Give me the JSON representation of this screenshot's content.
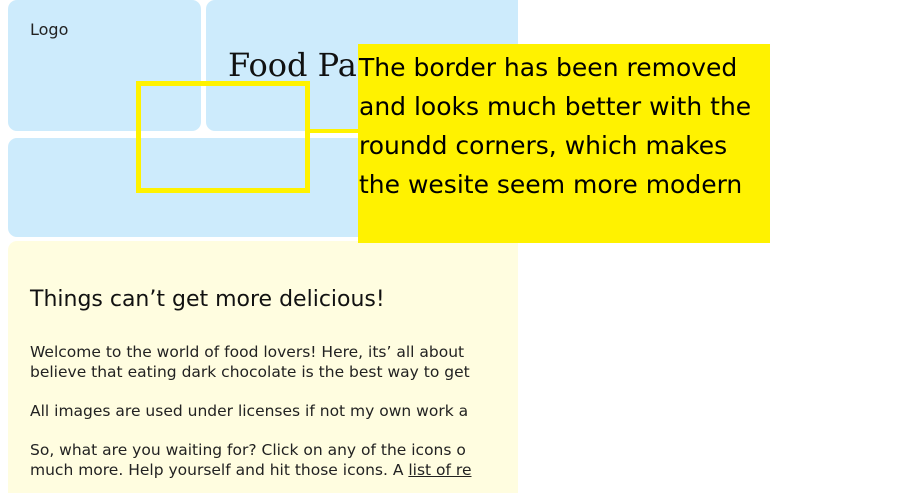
{
  "header": {
    "logo": "Logo",
    "title": "Food Pa"
  },
  "content": {
    "heading": "Things can’t get more delicious!",
    "paragraph1_line1": "Welcome to the world of food lovers! Here, its’ all about",
    "paragraph1_line2": "believe that eating dark chocolate is the best way to get",
    "paragraph2": "All images are used under licenses if not my own work a",
    "paragraph3_line1": "So, what are you waiting for? Click on any of the icons o",
    "paragraph3_line2_prefix": "much more. Help yourself and hit those icons. A ",
    "paragraph3_link": "list of re"
  },
  "annotation": {
    "lines": [
      "The border has been removed",
      "and looks much better with the",
      "roundd corners, which makes",
      "the wesite seem more modern"
    ],
    "color": "#fff200"
  },
  "colors": {
    "panel_blue": "#cdebfc",
    "panel_cream": "#fffde0"
  }
}
